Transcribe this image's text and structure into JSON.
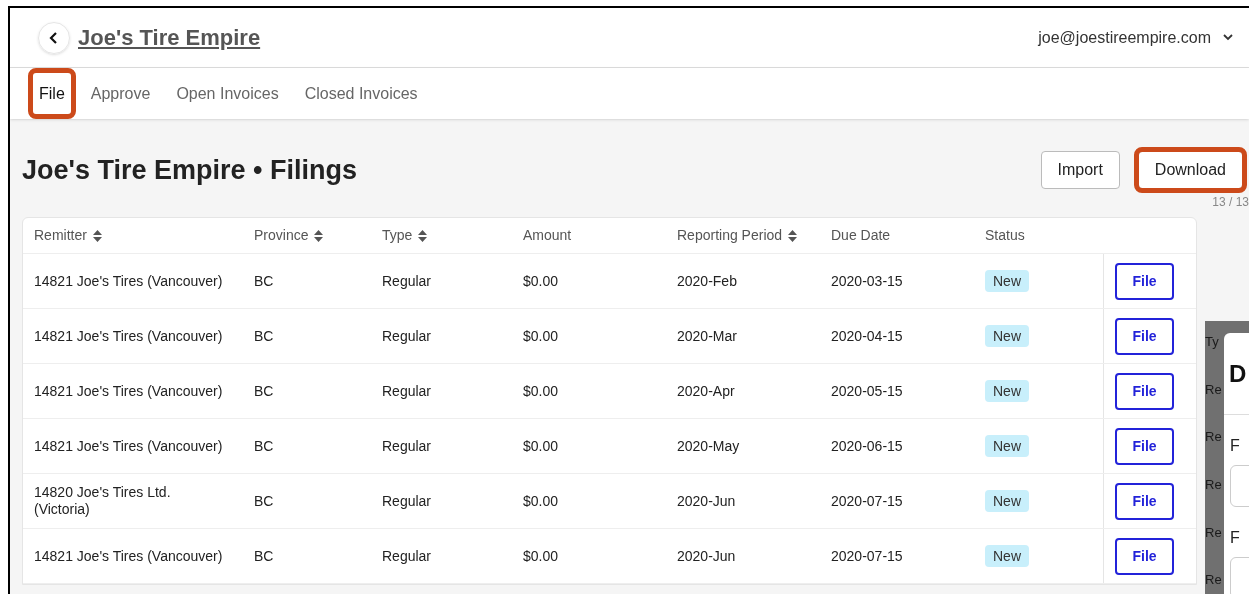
{
  "header": {
    "company": "Joe's Tire Empire",
    "user_email": "joe@joestireempire.com"
  },
  "tabs": [
    {
      "label": "File",
      "selected": true,
      "highlighted": true
    },
    {
      "label": "Approve",
      "selected": false,
      "highlighted": false
    },
    {
      "label": "Open Invoices",
      "selected": false,
      "highlighted": false
    },
    {
      "label": "Closed Invoices",
      "selected": false,
      "highlighted": false
    }
  ],
  "page": {
    "title": "Joe's Tire Empire • Filings",
    "actions": [
      {
        "label": "Import",
        "highlighted": false
      },
      {
        "label": "Download",
        "highlighted": true
      }
    ],
    "count": "13 / 13"
  },
  "table": {
    "columns": [
      {
        "label": "Remitter",
        "sortable": true
      },
      {
        "label": "Province",
        "sortable": true
      },
      {
        "label": "Type",
        "sortable": true
      },
      {
        "label": "Amount",
        "sortable": false
      },
      {
        "label": "Reporting Period",
        "sortable": true
      },
      {
        "label": "Due Date",
        "sortable": false
      },
      {
        "label": "Status",
        "sortable": false
      }
    ],
    "rows": [
      {
        "remitter": "14821 Joe's Tires (Vancouver)",
        "province": "BC",
        "type": "Regular",
        "amount": "$0.00",
        "period": "2020-Feb",
        "due": "2020-03-15",
        "status": "New",
        "action": "File"
      },
      {
        "remitter": "14821 Joe's Tires (Vancouver)",
        "province": "BC",
        "type": "Regular",
        "amount": "$0.00",
        "period": "2020-Mar",
        "due": "2020-04-15",
        "status": "New",
        "action": "File"
      },
      {
        "remitter": "14821 Joe's Tires (Vancouver)",
        "province": "BC",
        "type": "Regular",
        "amount": "$0.00",
        "period": "2020-Apr",
        "due": "2020-05-15",
        "status": "New",
        "action": "File"
      },
      {
        "remitter": "14821 Joe's Tires (Vancouver)",
        "province": "BC",
        "type": "Regular",
        "amount": "$0.00",
        "period": "2020-May",
        "due": "2020-06-15",
        "status": "New",
        "action": "File"
      },
      {
        "remitter": "14820 Joe's Tires Ltd. (Victoria)",
        "province": "BC",
        "type": "Regular",
        "amount": "$0.00",
        "period": "2020-Jun",
        "due": "2020-07-15",
        "status": "New",
        "action": "File"
      },
      {
        "remitter": "14821 Joe's Tires (Vancouver)",
        "province": "BC",
        "type": "Regular",
        "amount": "$0.00",
        "period": "2020-Jun",
        "due": "2020-07-15",
        "status": "New",
        "action": "File"
      }
    ]
  },
  "overlay": {
    "background_texts": [
      "Ty",
      "Re",
      "Re",
      "Re",
      "Re",
      "Re"
    ],
    "dialog": {
      "title": "D",
      "fields": [
        {
          "label": "F"
        },
        {
          "label": "F"
        }
      ]
    }
  }
}
